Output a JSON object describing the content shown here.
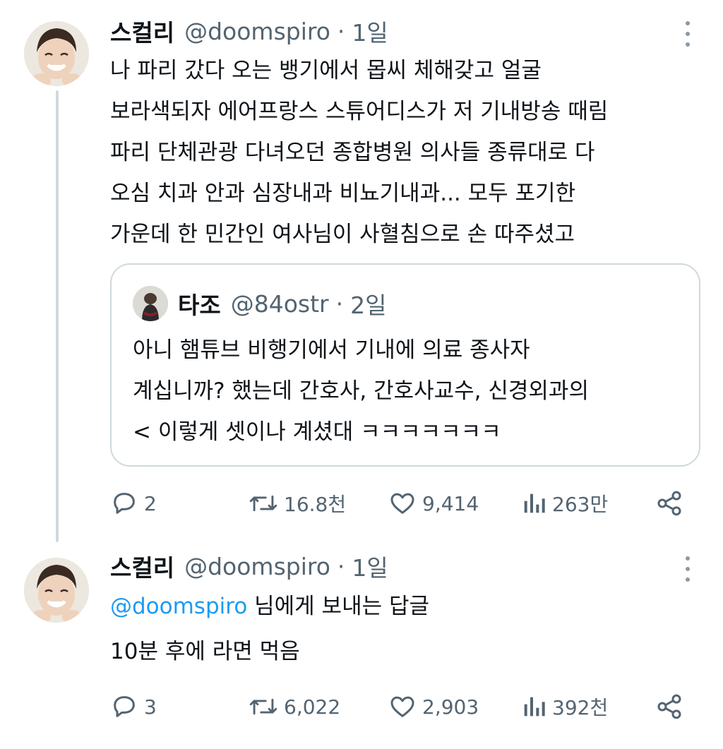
{
  "tweets": [
    {
      "name": "스컬리",
      "handle": "@doomspiro",
      "dot": "·",
      "time": "1일",
      "lines": [
        "나 파리 갔다 오는 뱅기에서 몹씨 체해갖고 얼굴",
        "보라색되자 에어프랑스 스튜어디스가 저 기내방송 때림",
        "파리 단체관광 다녀오던 종합병원 의사들 종류대로 다",
        "오심 치과 안과 심장내과 비뇨기내과... 모두 포기한",
        "가운데 한 민간인 여사님이 사혈침으로 손 따주셨고"
      ],
      "quote": {
        "name": "타조",
        "handle": "@84ostr",
        "dot": "·",
        "time": "2일",
        "lines": [
          "아니 햄튜브 비행기에서 기내에 의료 종사자",
          "계십니까? 했는데 간호사, 간호사교수, 신경외과의",
          "< 이렇게 셋이나 계셨대 ㅋㅋㅋㅋㅋㅋㅋ"
        ]
      },
      "actions": {
        "replies": "2",
        "retweets": "16.8천",
        "likes": "9,414",
        "views": "263만"
      }
    },
    {
      "name": "스컬리",
      "handle": "@doomspiro",
      "dot": "·",
      "time": "1일",
      "reply_mention": "@doomspiro",
      "reply_suffix": " 님에게 보내는 답글",
      "text": "10분 후에 라면 먹음",
      "actions": {
        "replies": "3",
        "retweets": "6,022",
        "likes": "2,903",
        "views": "392천"
      }
    }
  ],
  "colors": {
    "text": "#0f1419",
    "secondary": "#536471",
    "accent": "#1d9bf0",
    "border": "#cfd9de"
  },
  "icons": [
    "more-icon",
    "reply-icon",
    "retweet-icon",
    "like-icon",
    "views-icon",
    "share-icon"
  ]
}
